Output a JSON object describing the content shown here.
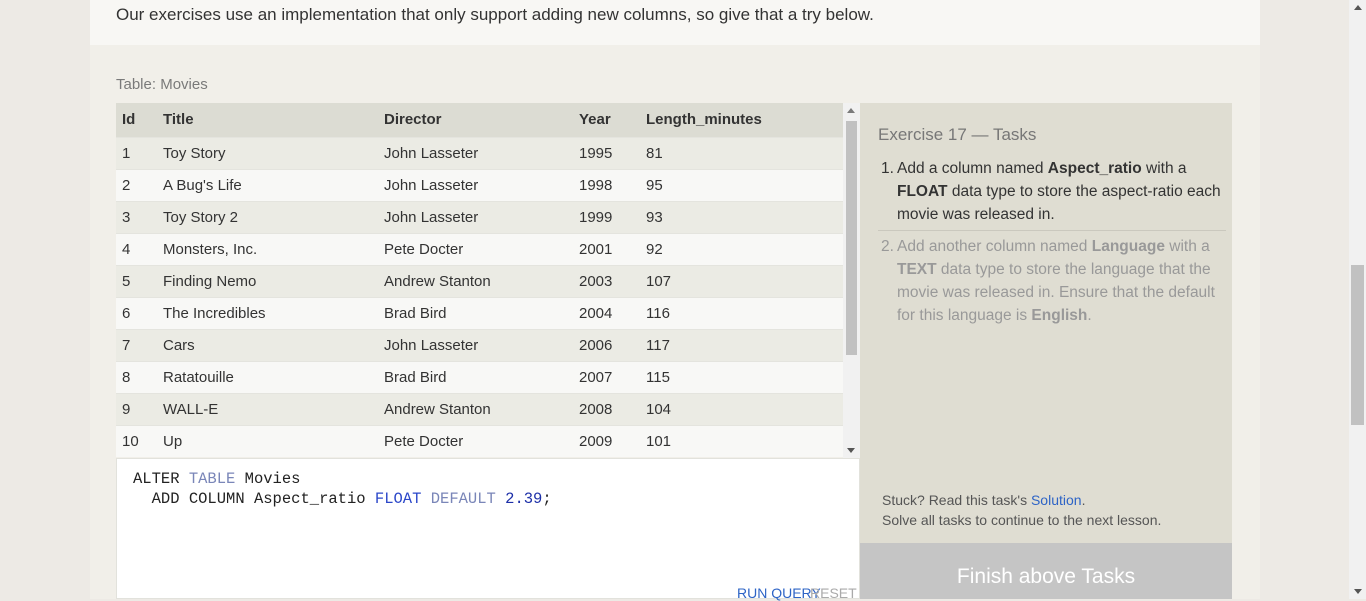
{
  "intro": {
    "text": "Our exercises use an implementation that only support adding new columns, so give that a try below."
  },
  "table": {
    "label": "Table: Movies",
    "columns": [
      "Id",
      "Title",
      "Director",
      "Year",
      "Length_minutes"
    ],
    "rows": [
      [
        "1",
        "Toy Story",
        "John Lasseter",
        "1995",
        "81"
      ],
      [
        "2",
        "A Bug's Life",
        "John Lasseter",
        "1998",
        "95"
      ],
      [
        "3",
        "Toy Story 2",
        "John Lasseter",
        "1999",
        "93"
      ],
      [
        "4",
        "Monsters, Inc.",
        "Pete Docter",
        "2001",
        "92"
      ],
      [
        "5",
        "Finding Nemo",
        "Andrew Stanton",
        "2003",
        "107"
      ],
      [
        "6",
        "The Incredibles",
        "Brad Bird",
        "2004",
        "116"
      ],
      [
        "7",
        "Cars",
        "John Lasseter",
        "2006",
        "117"
      ],
      [
        "8",
        "Ratatouille",
        "Brad Bird",
        "2007",
        "115"
      ],
      [
        "9",
        "WALL-E",
        "Andrew Stanton",
        "2008",
        "104"
      ],
      [
        "10",
        "Up",
        "Pete Docter",
        "2009",
        "101"
      ]
    ]
  },
  "editor": {
    "line1": {
      "kw_alter": "ALTER",
      "kw_table": "TABLE",
      "name": "Movies"
    },
    "line2": {
      "kw_add": "ADD",
      "kw_column": "COLUMN",
      "column_name": "Aspect_ratio",
      "type": "FLOAT",
      "kw_default": "DEFAULT",
      "value": "2.39",
      "terminator": ";"
    },
    "run_label": "RUN QUERY",
    "reset_label": "RESET"
  },
  "tasks": {
    "title": "Exercise 17 — Tasks",
    "items": [
      {
        "num": "1.",
        "p1": "Add a column named ",
        "b1": "Aspect_ratio",
        "p2": " with a ",
        "b2": "FLOAT",
        "p3": " data type to store the aspect-ratio each movie was released in."
      },
      {
        "num": "2.",
        "p1": "Add another column named ",
        "b1": "Language",
        "p2": " with a ",
        "b2": "TEXT",
        "p3": " data type to store the language that the movie was released in. Ensure that the default for this language is ",
        "b3": "English",
        "p4": "."
      }
    ],
    "stuck_prefix": "Stuck? Read this task's ",
    "solution_link": "Solution",
    "stuck_suffix": ".",
    "solve_all": "Solve all tasks to continue to the next lesson.",
    "finish_label": "Finish above Tasks"
  },
  "colors": {
    "link": "#2e64c6",
    "keyword_soft": "#7a86b8",
    "keyword_strong": "#2b47c9",
    "number": "#1c2fa8",
    "finish_button": "#c5c5c5"
  }
}
